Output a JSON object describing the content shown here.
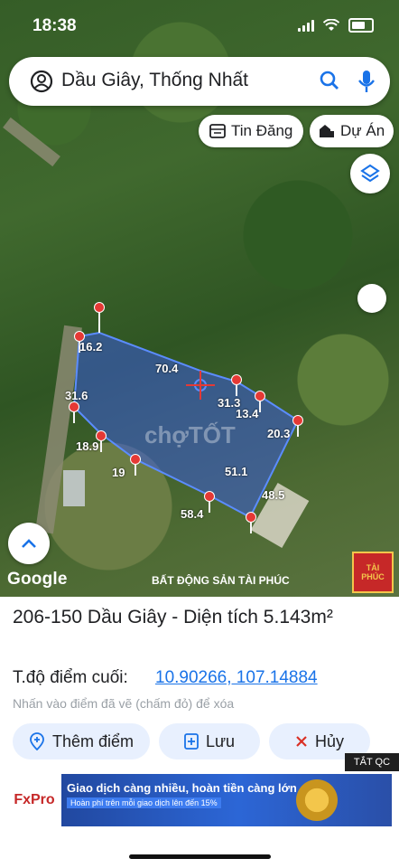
{
  "status": {
    "time": "18:38"
  },
  "search": {
    "query": "Dầu Giây, Thống Nhất"
  },
  "chips": {
    "listings": "Tin Đăng",
    "projects": "Dự Án"
  },
  "plot": {
    "edges": [
      "16.2",
      "70.4",
      "31.6",
      "31.3",
      "13.4",
      "20.3",
      "18.9",
      "19",
      "51.1",
      "48.5",
      "58.4"
    ],
    "watermark": "chợTỐT"
  },
  "map": {
    "google": "Google",
    "credit": "BẤT ĐỘNG SẢN TÀI PHÚC",
    "logo": "TÀI PHÚC"
  },
  "panel": {
    "title": "206-150 Dầu Giây - Diện tích 5.143m²",
    "coord_label": "T.độ điểm cuối:",
    "coord_value": "10.90266, 107.14884",
    "hint": "Nhấn vào điểm đã vẽ (chấm đỏ) để xóa",
    "add_point": "Thêm điểm",
    "save": "Lưu",
    "cancel": "Hủy",
    "ad_close": "TẮT QC"
  },
  "ad": {
    "brand": "FxPro",
    "headline": "Giao dịch càng nhiều, hoàn tiền càng lớn",
    "sub": "Hoàn phí trên mỗi giao dịch lên đến 15%"
  },
  "colors": {
    "accent": "#1a73e8",
    "pin": "#e53935",
    "polygon": "#3b5bdb"
  }
}
